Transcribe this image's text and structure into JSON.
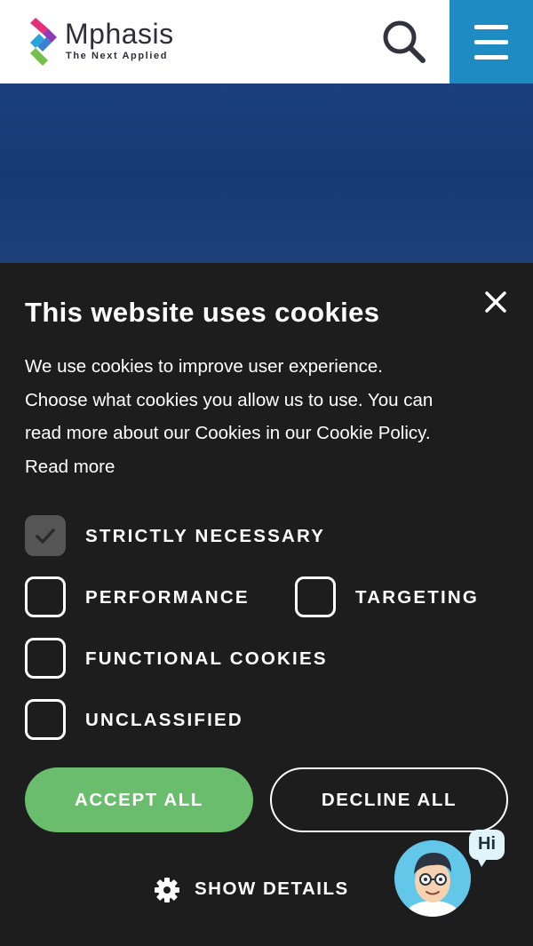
{
  "header": {
    "logo_name": "Mphasis",
    "logo_tagline": "The Next Applied",
    "search_icon": "search-icon",
    "menu_icon": "hamburger-menu-icon",
    "accent_color": "#1f8bc3"
  },
  "cookie_banner": {
    "title": "This website uses cookies",
    "body_lines": [
      "We use cookies to improve user experience.",
      "Choose what cookies you allow us to use. You can",
      "read more about our Cookies in our Cookie Policy."
    ],
    "read_more_label": "Read more",
    "close_icon": "close-icon",
    "options": [
      {
        "label": "STRICTLY NECESSARY",
        "checked": true
      },
      {
        "label": "PERFORMANCE",
        "checked": false
      },
      {
        "label": "TARGETING",
        "checked": false
      },
      {
        "label": "FUNCTIONAL COOKIES",
        "checked": false
      },
      {
        "label": "UNCLASSIFIED",
        "checked": false
      }
    ],
    "accept_all_label": "ACCEPT ALL",
    "decline_all_label": "DECLINE ALL",
    "show_details_label": "SHOW DETAILS",
    "accept_color": "#69bd6d",
    "background_color": "#1d1d1d"
  },
  "chat": {
    "bubble_text": "Hi",
    "avatar_icon": "chatbot-avatar-icon"
  }
}
